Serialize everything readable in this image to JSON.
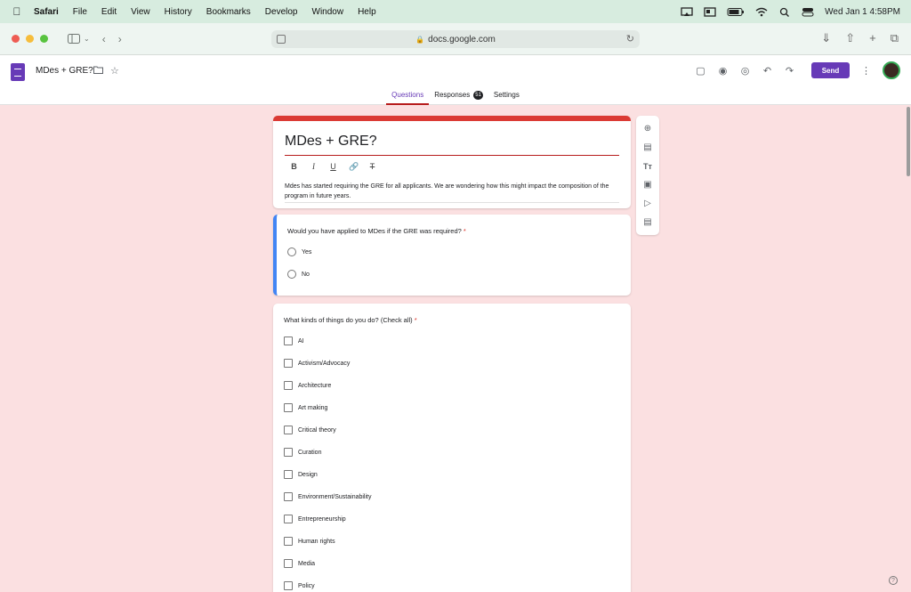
{
  "menubar": {
    "apple_icon": "apple-icon",
    "app": "Safari",
    "items": [
      "File",
      "Edit",
      "View",
      "History",
      "Bookmarks",
      "Develop",
      "Window",
      "Help"
    ],
    "clock": "Wed Jan 1  4:58PM"
  },
  "safari": {
    "url": "docs.google.com"
  },
  "forms": {
    "doc_title": "MDes + GRE?",
    "send_label": "Send",
    "tabs": [
      {
        "label": "Questions"
      },
      {
        "label": "Responses",
        "badge": "51"
      },
      {
        "label": "Settings"
      }
    ]
  },
  "form": {
    "title": "MDes + GRE?",
    "description": "Mdes has started requiring the GRE for all applicants. We are wondering how this might impact the composition of the program in future years.",
    "q1": {
      "title": "Would you have applied to MDes if the GRE was required?",
      "required_mark": "*",
      "options": [
        "Yes",
        "No"
      ]
    },
    "q2": {
      "title": "What kinds of things do you do? (Check all)",
      "required_mark": "*",
      "options": [
        "AI",
        "Activism/Advocacy",
        "Architecture",
        "Art making",
        "Critical theory",
        "Curation",
        "Design",
        "Environment/Sustainability",
        "Entrepreneurship",
        "Human rights",
        "Media",
        "Policy"
      ]
    }
  },
  "colors": {
    "accent": "#673ab7",
    "title_bar": "#db3a34",
    "active_question": "#4285f4",
    "background": "#fbe0e1"
  }
}
